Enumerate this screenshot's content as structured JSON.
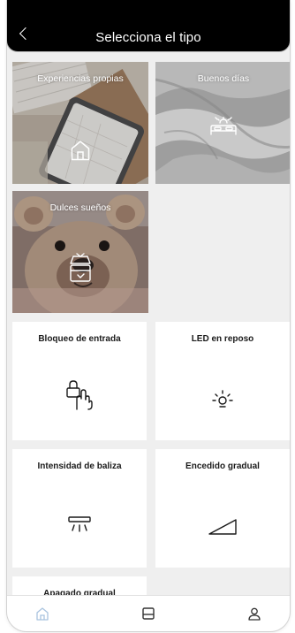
{
  "header": {
    "title": "Selecciona el tipo",
    "back_icon": "chevron-left-icon"
  },
  "scene_types": [
    {
      "title": "Experiencias propias",
      "icon": "house-icon"
    },
    {
      "title": "Buenos días",
      "icon": "bed-sunrise-icon"
    },
    {
      "title": "Dulces sueños",
      "icon": "bedside-clock-icon"
    }
  ],
  "device_types": [
    {
      "title": "Bloqueo de entrada",
      "icon": "lock-hand-icon"
    },
    {
      "title": "LED en reposo",
      "icon": "led-light-icon"
    },
    {
      "title": "Intensidad de baliza",
      "icon": "beacon-light-icon"
    },
    {
      "title": "Encedido gradual",
      "icon": "ramp-up-icon"
    },
    {
      "title": "Apagado gradual",
      "icon": "ramp-down-icon"
    }
  ],
  "tabbar": {
    "items": [
      {
        "name": "home",
        "icon": "home-icon",
        "active": true
      },
      {
        "name": "devices",
        "icon": "panel-icon",
        "active": false
      },
      {
        "name": "profile",
        "icon": "user-icon",
        "active": false
      }
    ],
    "active_color": "#a9c3df",
    "inactive_color": "#333333"
  }
}
